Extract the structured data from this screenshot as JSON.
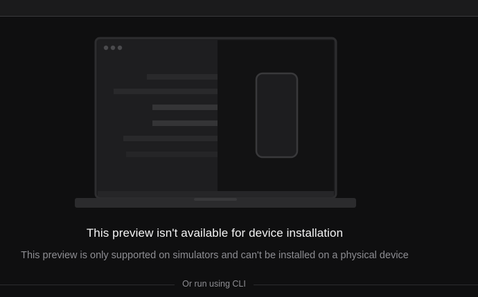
{
  "message": {
    "title": "This preview isn't available for device installation",
    "description": "This preview is only supported on simulators and can't be installed on a physical device"
  },
  "cli": {
    "label": "Or run using CLI"
  },
  "illustration": {
    "icon": "laptop-phone-illustration",
    "window_dots": 3,
    "code_lines": 6
  },
  "colors": {
    "background": "#0f0f10",
    "top_bar": "#1b1b1c",
    "laptop_frame": "#2b2b2d",
    "text_primary": "#f4f4f5",
    "text_secondary": "#8d8d92"
  }
}
